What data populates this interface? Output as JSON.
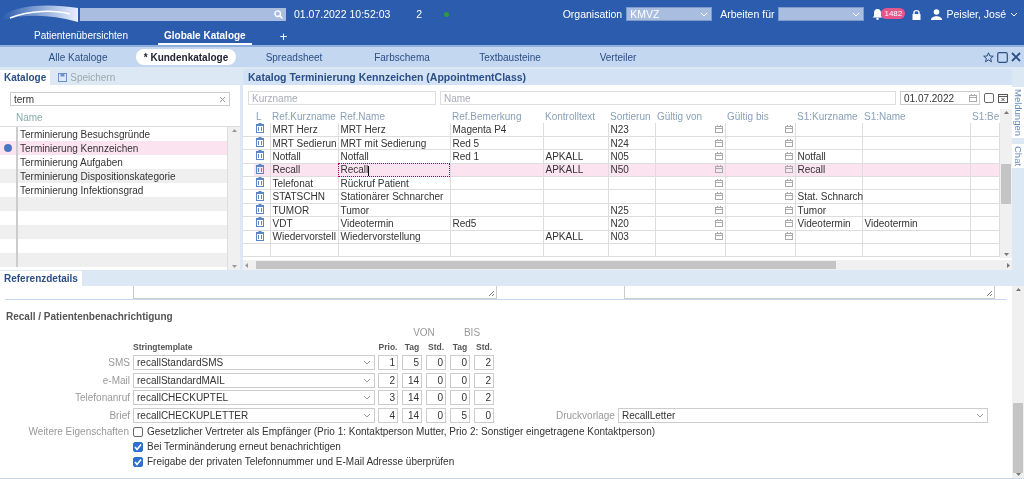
{
  "header": {
    "datetime": "01.07.2022 10:52:03",
    "counter": "2",
    "organisation": {
      "label": "Organisation",
      "value": "KMVZ"
    },
    "arbeiten_fuer": {
      "label": "Arbeiten für"
    },
    "notifications": "1482",
    "user": "Peisler, José"
  },
  "main_tabs": [
    {
      "label": "Patientenübersichten",
      "selected": false
    },
    {
      "label": "Globale Kataloge",
      "selected": true
    }
  ],
  "add_tab": "+",
  "sub_tabs": [
    {
      "label": "Alle Kataloge",
      "selected": false
    },
    {
      "label": "* Kundenkataloge",
      "selected": true
    },
    {
      "label": "Spreadsheet",
      "selected": false
    },
    {
      "label": "Farbschema",
      "selected": false
    },
    {
      "label": "Textbausteine",
      "selected": false
    },
    {
      "label": "Verteiler",
      "selected": false
    }
  ],
  "catalog_panel": {
    "tabs": [
      {
        "label": "Kataloge",
        "selected": true
      },
      {
        "label": "Speichern",
        "selected": false
      }
    ],
    "search": {
      "value": "term"
    },
    "column": "Name",
    "items": [
      {
        "label": "Terminierung Besuchsgründe",
        "selected": false
      },
      {
        "label": "Terminierung Kennzeichen",
        "selected": true
      },
      {
        "label": "Terminierung Aufgaben",
        "selected": false
      },
      {
        "label": "Terminierung Dispositionskategorie",
        "selected": false
      },
      {
        "label": "Terminierung Infektionsgrad",
        "selected": false
      }
    ]
  },
  "table": {
    "title": "Katalog Terminierung Kennzeichen (AppointmentClass)",
    "filters": {
      "kurzname": {
        "placeholder": "Kurzname"
      },
      "name": {
        "placeholder": "Name"
      },
      "date": {
        "value": "01.07.2022"
      },
      "checkbox": {
        "checked": false
      }
    },
    "columns": [
      {
        "label": "L",
        "kind": "icon"
      },
      {
        "label": "Ref.Kurzname",
        "kind": "text"
      },
      {
        "label": "Ref.Name",
        "kind": "text"
      },
      {
        "label": "Ref.Bemerkung",
        "kind": "text"
      },
      {
        "label": "Kontrolltext",
        "kind": "text"
      },
      {
        "label": "Sortierun",
        "kind": "text"
      },
      {
        "label": "Gültig von",
        "kind": "date"
      },
      {
        "label": "Gültig bis",
        "kind": "date"
      },
      {
        "label": "S1:Kurzname",
        "kind": "text"
      },
      {
        "label": "S1:Name",
        "kind": "text"
      },
      {
        "label": "S1:Be",
        "kind": "text"
      }
    ],
    "rows": [
      {
        "selected": false,
        "editing": false,
        "cells": [
          null,
          "MRT Herz",
          "MRT Herz",
          "Magenta P4",
          null,
          "N23",
          null,
          null,
          null,
          null,
          null
        ]
      },
      {
        "selected": false,
        "editing": false,
        "cells": [
          null,
          "MRT Sedierun",
          "MRT mit Sedierung",
          "Red 5",
          null,
          "N24",
          null,
          null,
          null,
          null,
          null
        ]
      },
      {
        "selected": false,
        "editing": false,
        "cells": [
          null,
          "Notfall",
          "Notfall",
          "Red 1",
          "APKALL",
          "N05",
          null,
          null,
          "Notfall",
          null,
          null
        ]
      },
      {
        "selected": true,
        "editing": true,
        "cells": [
          null,
          "Recall",
          "Recall",
          null,
          "APKALL",
          "N50",
          null,
          null,
          "Recall",
          null,
          null
        ]
      },
      {
        "selected": false,
        "editing": false,
        "cells": [
          null,
          "Telefonat",
          "Rückruf Patient",
          null,
          null,
          null,
          null,
          null,
          null,
          null,
          null
        ]
      },
      {
        "selected": false,
        "editing": false,
        "cells": [
          null,
          "STATSCHN",
          "Stationärer Schnarcher",
          null,
          null,
          null,
          null,
          null,
          "Stat. Schnarch",
          null,
          null
        ]
      },
      {
        "selected": false,
        "editing": false,
        "cells": [
          null,
          "TUMOR",
          "Tumor",
          null,
          null,
          "N25",
          null,
          null,
          "Tumor",
          null,
          null
        ]
      },
      {
        "selected": false,
        "editing": false,
        "cells": [
          null,
          "VDT",
          "Videotermin",
          "Red5",
          null,
          "N20",
          null,
          null,
          "Videotermin",
          "Videotermin",
          null
        ]
      },
      {
        "selected": false,
        "editing": false,
        "cells": [
          null,
          "Wiedervorstell",
          "Wiedervorstellung",
          null,
          "APKALL",
          "N03",
          null,
          null,
          null,
          null,
          null
        ]
      }
    ]
  },
  "side_tabs": [
    "Meldungen",
    "Chat"
  ],
  "details": {
    "tab": "Referenzdetails",
    "section": "Recall / Patientenbenachrichtigung",
    "group_headers": [
      "VON",
      "BIS"
    ],
    "columns": [
      "Stringtemplate",
      "Prio.",
      "Tag",
      "Std.",
      "Tag",
      "Std."
    ],
    "channels": [
      {
        "label": "SMS",
        "template": "recallStandardSMS",
        "values": [
          "1",
          "5",
          "0",
          "0",
          "2"
        ]
      },
      {
        "label": "e-Mail",
        "template": "recallStandardMAIL",
        "values": [
          "2",
          "14",
          "0",
          "0",
          "2"
        ]
      },
      {
        "label": "Telefonanruf",
        "template": "recallCHECKUPTEL",
        "values": [
          "3",
          "14",
          "0",
          "0",
          "2"
        ]
      },
      {
        "label": "Brief",
        "template": "recallCHECKUPLETTER",
        "values": [
          "4",
          "14",
          "0",
          "5",
          "0"
        ]
      }
    ],
    "print_template": {
      "label": "Druckvorlage",
      "value": "RecallLetter"
    },
    "properties": {
      "label": "Weitere Eigenschaften",
      "options": [
        {
          "label": "Gesetzlicher Vertreter als Empfänger (Prio 1: Kontaktperson Mutter, Prio 2: Sonstiger eingetragene Kontaktperson)",
          "checked": false
        },
        {
          "label": "Bei Terminänderung erneut benachrichtigen",
          "checked": true
        },
        {
          "label": "Freigabe der privaten Telefonnummer und E-Mail Adresse überprüfen",
          "checked": true
        }
      ]
    }
  }
}
